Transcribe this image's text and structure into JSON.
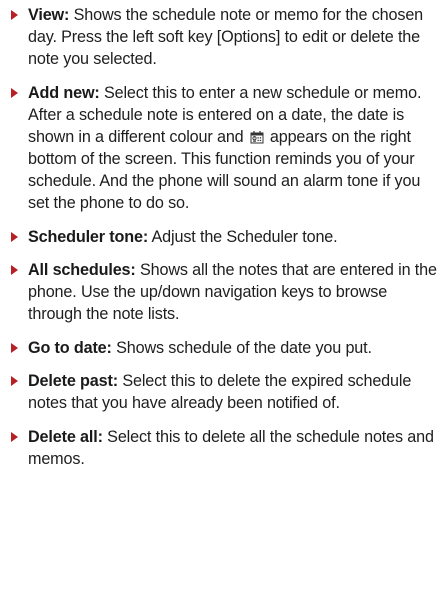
{
  "items": [
    {
      "term": "View:",
      "text": " Shows the schedule note or memo for the chosen day. Press the left soft key [Options] to edit or delete the note you selected."
    },
    {
      "term": "Add new:",
      "text_before_icon": " Select this to enter a new schedule or memo. After a schedule note is entered on a date, the date is shown in a different colour and",
      "icon": "memo-icon",
      "text_after_icon": " appears on the right bottom of the screen. This function reminds you of your schedule. And the phone will sound an alarm tone if you set the phone to do so."
    },
    {
      "term": "Scheduler tone:",
      "text": " Adjust the Scheduler tone."
    },
    {
      "term": "All schedules:",
      "text": " Shows all the notes that are entered in the phone. Use the up/down navigation keys to browse through the note lists."
    },
    {
      "term": "Go to date:",
      "text": " Shows schedule of the date you put."
    },
    {
      "term": "Delete past:",
      "text": " Select this to delete the expired schedule notes that you have already been notified of."
    },
    {
      "term": "Delete all:",
      "text": " Select this to delete all the schedule notes and memos."
    }
  ],
  "colors": {
    "bullet": "#b81f26",
    "text": "#1e1e1e"
  }
}
